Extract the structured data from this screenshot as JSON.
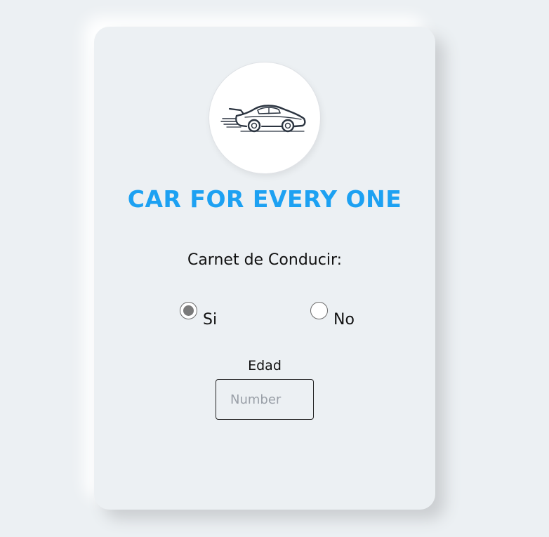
{
  "brand": {
    "title": "CAR FOR EVERY ONE",
    "logo_icon": "sports-car-icon",
    "accent_color": "#1da1f2"
  },
  "form": {
    "license_question": "Carnet de Conducir:",
    "license_options": [
      {
        "label": "Si",
        "selected": true
      },
      {
        "label": "No",
        "selected": false
      }
    ],
    "age_label": "Edad",
    "age_input": {
      "value": "",
      "placeholder": "Number"
    }
  }
}
